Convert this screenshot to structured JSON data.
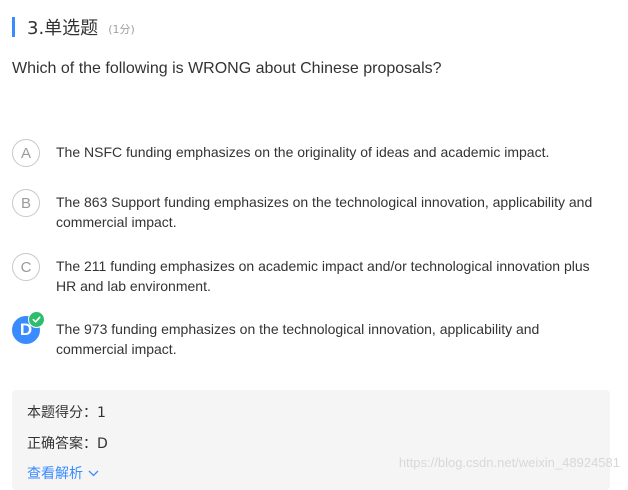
{
  "question": {
    "title": "3.单选题",
    "score_label": "(1分)",
    "text": "Which of the following is WRONG about Chinese proposals?"
  },
  "options": [
    {
      "letter": "A",
      "text": "The NSFC funding emphasizes on the originality of ideas and academic impact.",
      "selected": false
    },
    {
      "letter": "B",
      "text": "The 863 Support funding emphasizes on the technological innovation, applicability and commercial impact.",
      "selected": false
    },
    {
      "letter": "C",
      "text": "The 211 funding emphasizes on academic impact and/or technological innovation plus HR and lab environment.",
      "selected": false
    },
    {
      "letter": "D",
      "text": "The 973 funding emphasizes on the technological innovation, applicability and commercial impact.",
      "selected": true
    }
  ],
  "result": {
    "score_text": "本题得分：1",
    "answer_text": "正确答案：D",
    "view_analysis_label": "查看解析"
  },
  "icons": {
    "correct": "check-icon",
    "expand": "chevron-down-icon"
  },
  "watermark": "https://blog.csdn.net/weixin_48924581",
  "colors": {
    "accent": "#3a8bff",
    "correct": "#2dbe6c",
    "panel": "#f5f5f5"
  }
}
